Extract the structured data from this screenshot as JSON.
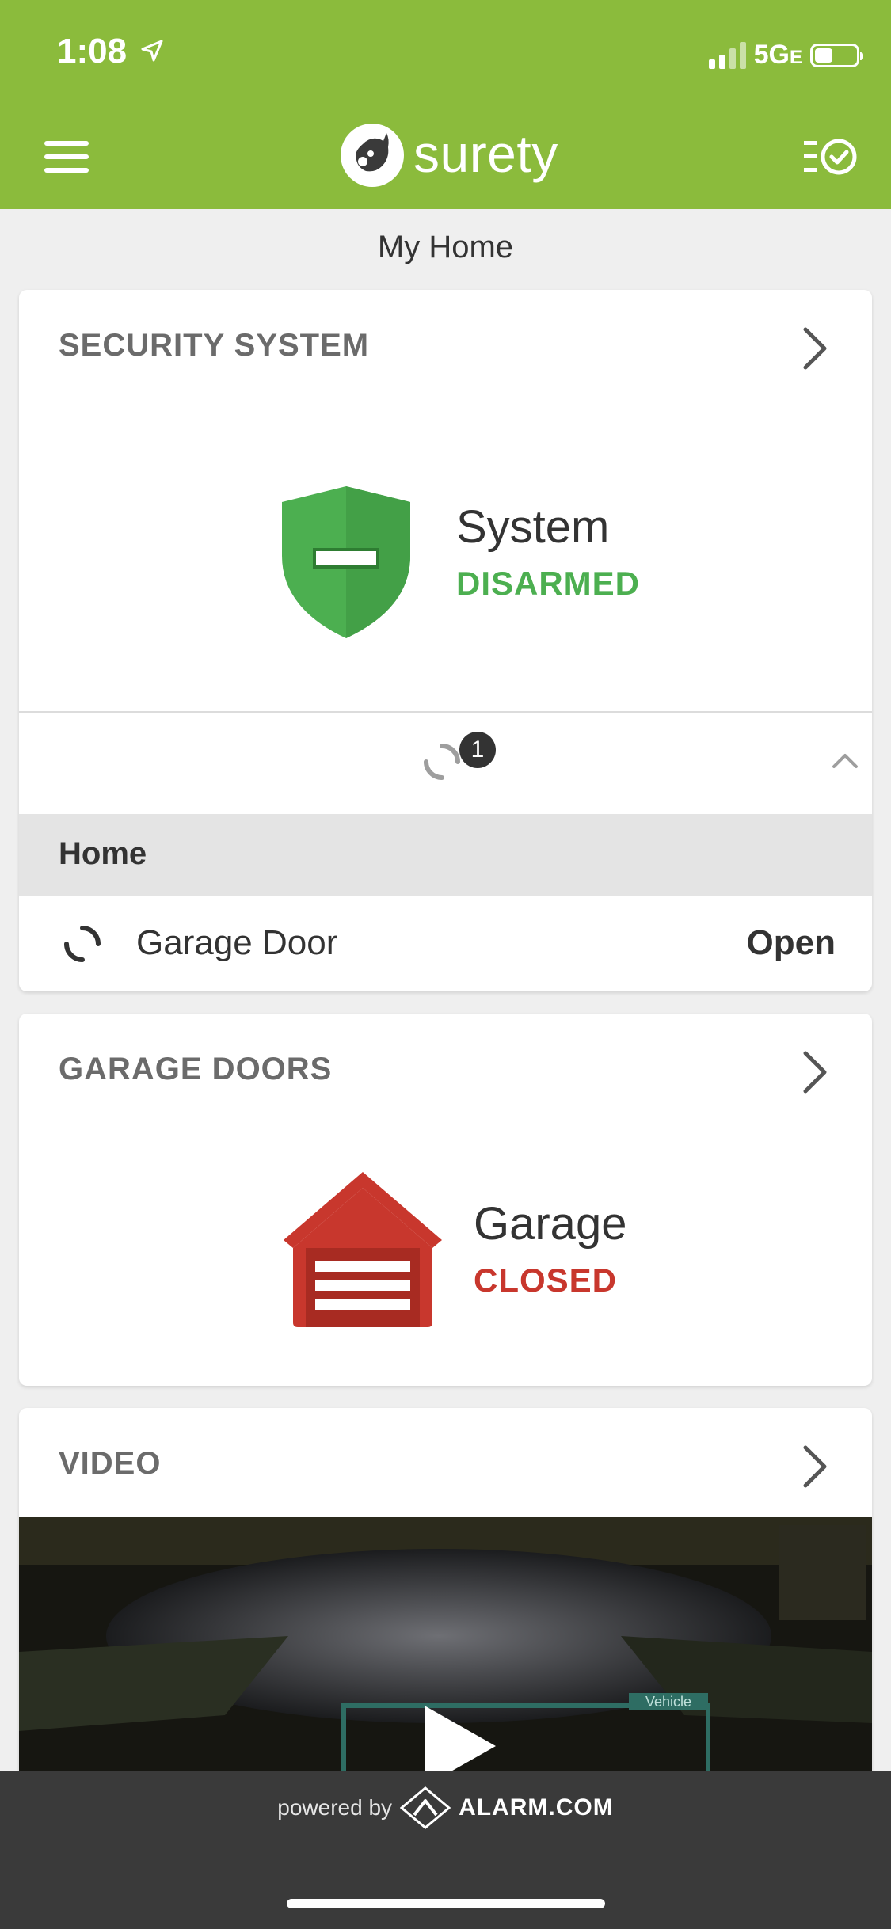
{
  "status_bar": {
    "time": "1:08",
    "network": "5G",
    "network_suffix": "E"
  },
  "header": {
    "brand": "surety"
  },
  "page": {
    "title": "My Home"
  },
  "security": {
    "heading": "SECURITY SYSTEM",
    "status_title": "System",
    "status_value": "DISARMED",
    "badge_count": "1",
    "group_label": "Home",
    "items": [
      {
        "name": "Garage Door",
        "state": "Open"
      }
    ]
  },
  "garage": {
    "heading": "GARAGE DOORS",
    "status_title": "Garage",
    "status_value": "CLOSED"
  },
  "video": {
    "heading": "VIDEO",
    "overlay_tag": "Vehicle"
  },
  "footer": {
    "powered_by": "powered by",
    "provider": "ALARM.COM"
  },
  "colors": {
    "brand_green": "#8bbb3c",
    "disarmed_green": "#4caf50",
    "closed_red": "#c8372d"
  }
}
